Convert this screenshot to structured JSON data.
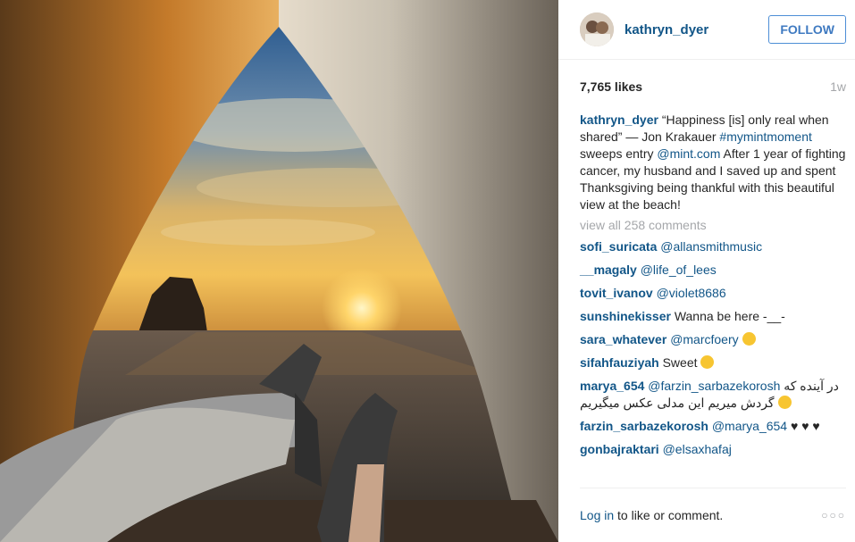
{
  "post": {
    "username": "kathryn_dyer",
    "follow_label": "FOLLOW",
    "likes": "7,765 likes",
    "time": "1w",
    "caption": {
      "username": "kathryn_dyer",
      "text1": " “Happiness [is] only real when shared” — Jon Krakauer ",
      "hashtag": "#mymintmoment",
      "text2": " sweeps entry ",
      "mention": "@mint.com",
      "text3": " After 1 year of fighting cancer, my husband and I saved up and spent Thanksgiving being thankful with this beautiful view at the beach!"
    },
    "view_all": "view all 258 comments",
    "comments": [
      {
        "user": "sofi_suricata",
        "mention": "@allansmithmusic",
        "text": ""
      },
      {
        "user": "__magaly",
        "mention": "@life_of_lees",
        "text": ""
      },
      {
        "user": "tovit_ivanov",
        "mention": "@violet8686",
        "text": ""
      },
      {
        "user": "sunshinekisser",
        "mention": "",
        "text": "Wanna be here -__-"
      },
      {
        "user": "sara_whatever",
        "mention": "@marcfoery",
        "text": ""
      },
      {
        "user": "sifahfauziyah",
        "mention": "",
        "text": "Sweet"
      },
      {
        "user": "marya_654",
        "mention": "@farzin_sarbazekorosh",
        "text": "در آینده که گردش میریم این مدلی عکس میگیریم"
      },
      {
        "user": "farzin_sarbazekorosh",
        "mention": "@marya_654",
        "text": "♥ ♥ ♥"
      },
      {
        "user": "gonbajraktari",
        "mention": "@elsaxhafaj",
        "text": ""
      }
    ],
    "footer": {
      "login": "Log in",
      "rest": " to like or comment.",
      "more": "○○○"
    }
  }
}
